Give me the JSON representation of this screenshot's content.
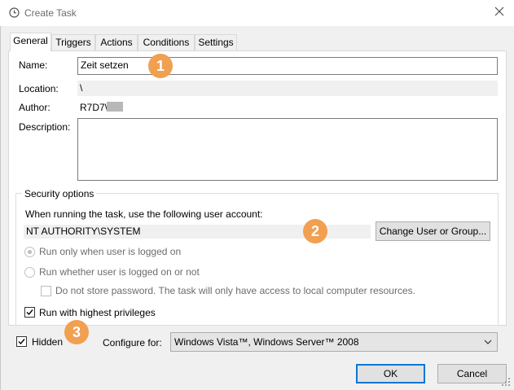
{
  "window": {
    "title": "Create Task",
    "app_icon": "clock-icon",
    "close_icon": "close-icon"
  },
  "tabs": [
    {
      "label": "General",
      "active": true
    },
    {
      "label": "Triggers",
      "active": false
    },
    {
      "label": "Actions",
      "active": false
    },
    {
      "label": "Conditions",
      "active": false
    },
    {
      "label": "Settings",
      "active": false
    }
  ],
  "general": {
    "name_label": "Name:",
    "name_value": "Zeit setzen",
    "location_label": "Location:",
    "location_value": "\\",
    "author_label": "Author:",
    "author_value": "R7D7\\",
    "description_label": "Description:",
    "description_value": ""
  },
  "security": {
    "group_label": "Security options",
    "account_prompt": "When running the task, use the following user account:",
    "account_value": "NT AUTHORITY\\SYSTEM",
    "change_button": "Change User or Group...",
    "radio_logged_on": "Run only when user is logged on",
    "radio_whether": "Run whether user is logged on or not",
    "no_store_password": "Do not store password.  The task will only have access to local computer resources.",
    "highest_privileges": "Run with highest privileges"
  },
  "bottom": {
    "hidden_label": "Hidden",
    "configure_label": "Configure for:",
    "configure_value": "Windows Vista™, Windows Server™ 2008",
    "ok_button": "OK",
    "cancel_button": "Cancel"
  },
  "annotations": [
    "1",
    "2",
    "3"
  ],
  "colors": {
    "badge": "#f0a050",
    "accent": "#0078d7"
  }
}
